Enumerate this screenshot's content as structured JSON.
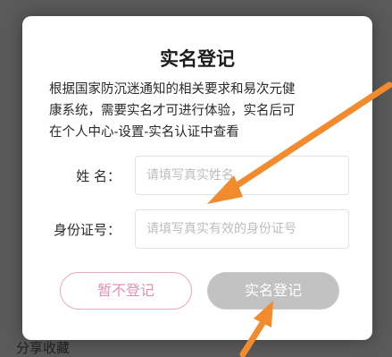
{
  "background": {
    "bottom_text": "分享收藏"
  },
  "dialog": {
    "title": "实名登记",
    "notice_lines": [
      "根据国家防沉迷通知的相关要求和易次元健",
      "康系统，需要实名才可进行体验，实名后可",
      "在个人中心-设置-实名认证中查看"
    ],
    "name_label": "姓  名：",
    "name_placeholder": "请填写真实姓名",
    "id_label": "身份证号：",
    "id_placeholder": "请填写真实有效的身份证号",
    "cancel_label": "暂不登记",
    "confirm_label": "实名登记"
  },
  "colors": {
    "accent_pink": "#e291b0",
    "button_disabled_gray": "#c2c2c2",
    "annotation_arrow_orange": "#f28a2e"
  }
}
